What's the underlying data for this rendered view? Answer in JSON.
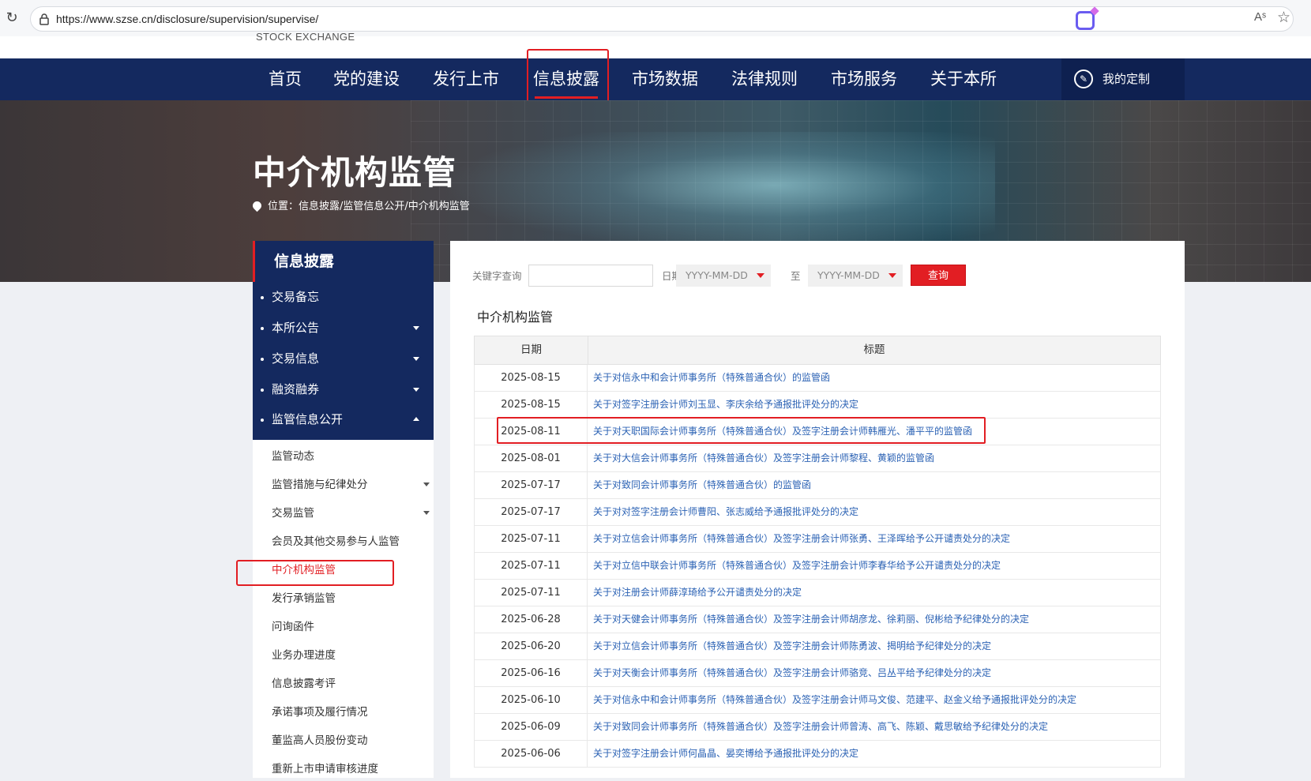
{
  "browser": {
    "url": "https://www.szse.cn/disclosure/supervision/supervise/",
    "reload_icon": "reload-icon",
    "lock_icon": "lock-icon",
    "read_aloud_label": "Aˢ",
    "favorite_icon": "star-icon"
  },
  "logo": {
    "text": "STOCK EXCHANGE"
  },
  "nav": {
    "items": [
      "首页",
      "党的建设",
      "发行上市",
      "信息披露",
      "市场数据",
      "法律规则",
      "市场服务",
      "关于本所"
    ],
    "active_index": 3,
    "custom_label": "我的定制",
    "custom_icon": "customize-icon"
  },
  "banner": {
    "title": "中介机构监管",
    "breadcrumb": "位置：信息披露/监管信息公开/中介机构监管"
  },
  "sidebar": {
    "header": "信息披露",
    "items": [
      {
        "label": "交易备忘",
        "caret": "none"
      },
      {
        "label": "本所公告",
        "caret": "down"
      },
      {
        "label": "交易信息",
        "caret": "down"
      },
      {
        "label": "融资融券",
        "caret": "down"
      },
      {
        "label": "监管信息公开",
        "caret": "up"
      }
    ],
    "subitems": [
      {
        "label": "监管动态",
        "caret": "none"
      },
      {
        "label": "监管措施与纪律处分",
        "caret": "down"
      },
      {
        "label": "交易监管",
        "caret": "down"
      },
      {
        "label": "会员及其他交易参与人监管",
        "caret": "none"
      },
      {
        "label": "中介机构监管",
        "caret": "none",
        "active": true
      },
      {
        "label": "发行承销监管",
        "caret": "none"
      },
      {
        "label": "问询函件",
        "caret": "none"
      },
      {
        "label": "业务办理进度",
        "caret": "none"
      },
      {
        "label": "信息披露考评",
        "caret": "none"
      },
      {
        "label": "承诺事项及履行情况",
        "caret": "none"
      },
      {
        "label": "董监高人员股份变动",
        "caret": "none"
      },
      {
        "label": "重新上市申请审核进度",
        "caret": "none"
      }
    ]
  },
  "search": {
    "keyword_label": "关键字查询",
    "keyword_value": "",
    "date_label": "日期",
    "date_from_placeholder": "YYYY-MM-DD",
    "to_label": "至",
    "date_to_placeholder": "YYYY-MM-DD",
    "query_label": "查询"
  },
  "section_title": "中介机构监管",
  "table": {
    "headers": [
      "日期",
      "标题"
    ],
    "rows": [
      {
        "date": "2025-08-15",
        "title": "关于对信永中和会计师事务所（特殊普通合伙）的监管函"
      },
      {
        "date": "2025-08-15",
        "title": "关于对签字注册会计师刘玉显、李庆余给予通报批评处分的决定"
      },
      {
        "date": "2025-08-11",
        "title": "关于对天职国际会计师事务所（特殊普通合伙）及签字注册会计师韩雁光、潘平平的监管函"
      },
      {
        "date": "2025-08-01",
        "title": "关于对大信会计师事务所（特殊普通合伙）及签字注册会计师黎程、黄颖的监管函"
      },
      {
        "date": "2025-07-17",
        "title": "关于对致同会计师事务所（特殊普通合伙）的监管函"
      },
      {
        "date": "2025-07-17",
        "title": "关于对对签字注册会计师曹阳、张志威给予通报批评处分的决定"
      },
      {
        "date": "2025-07-11",
        "title": "关于对立信会计师事务所（特殊普通合伙）及签字注册会计师张勇、王泽晖给予公开谴责处分的决定"
      },
      {
        "date": "2025-07-11",
        "title": "关于对立信中联会计师事务所（特殊普通合伙）及签字注册会计师李春华给予公开谴责处分的决定"
      },
      {
        "date": "2025-07-11",
        "title": "关于对注册会计师薛淳琦给予公开谴责处分的决定"
      },
      {
        "date": "2025-06-28",
        "title": "关于对天健会计师事务所（特殊普通合伙）及签字注册会计师胡彦龙、徐莉丽、倪彬给予纪律处分的决定"
      },
      {
        "date": "2025-06-20",
        "title": "关于对立信会计师事务所（特殊普通合伙）及签字注册会计师陈勇波、揭明给予纪律处分的决定"
      },
      {
        "date": "2025-06-16",
        "title": "关于对天衡会计师事务所（特殊普通合伙）及签字注册会计师骆竞、吕丛平给予纪律处分的决定"
      },
      {
        "date": "2025-06-10",
        "title": "关于对信永中和会计师事务所（特殊普通合伙）及签字注册会计师马文俊、范建平、赵金义给予通报批评处分的决定"
      },
      {
        "date": "2025-06-09",
        "title": "关于对致同会计师事务所（特殊普通合伙）及签字注册会计师曾涛、高飞、陈颖、戴思敏给予纪律处分的决定"
      },
      {
        "date": "2025-06-06",
        "title": "关于对签字注册会计师何晶晶、晏奕博给予通报批评处分的决定"
      }
    ]
  },
  "colors": {
    "nav_bg": "#14295f",
    "accent": "#e21e23",
    "link": "#2b62b4"
  }
}
